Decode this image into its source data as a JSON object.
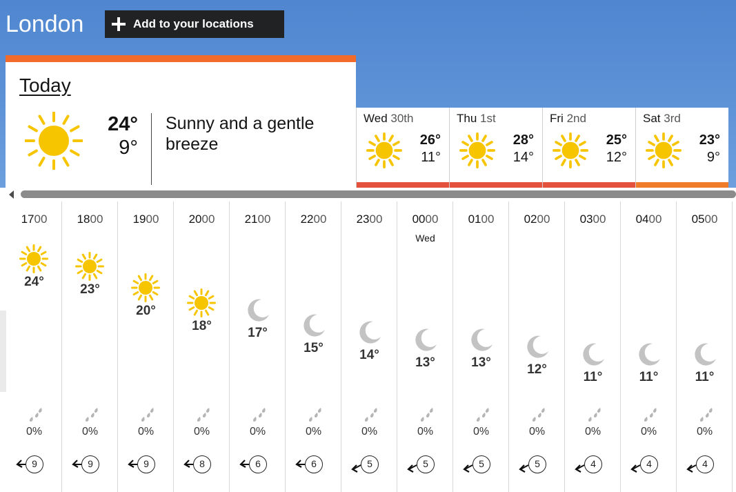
{
  "header": {
    "location": "London",
    "add_button_label": "Add to your locations"
  },
  "today": {
    "title": "Today",
    "icon": "sun-icon",
    "high": "24°",
    "low": "9°",
    "description": "Sunny and a gentle breeze"
  },
  "days": [
    {
      "day": "Wed",
      "date": "30th",
      "icon": "sun-icon",
      "high": "26°",
      "low": "11°",
      "bar_color": "#e4513c"
    },
    {
      "day": "Thu",
      "date": "1st",
      "icon": "sun-icon",
      "high": "28°",
      "low": "14°",
      "bar_color": "#e4513c"
    },
    {
      "day": "Fri",
      "date": "2nd",
      "icon": "sun-icon",
      "high": "25°",
      "low": "12°",
      "bar_color": "#e4513c"
    },
    {
      "day": "Sat",
      "date": "3rd",
      "icon": "sun-icon",
      "high": "23°",
      "low": "9°",
      "bar_color": "#f07c2a"
    }
  ],
  "hours": [
    {
      "hh": "17",
      "mm": "00",
      "day": "",
      "icon": "sun-icon",
      "temp": "24°",
      "rain": "0%",
      "wind": "9"
    },
    {
      "hh": "18",
      "mm": "00",
      "day": "",
      "icon": "sun-icon",
      "temp": "23°",
      "rain": "0%",
      "wind": "9"
    },
    {
      "hh": "19",
      "mm": "00",
      "day": "",
      "icon": "sun-icon",
      "temp": "20°",
      "rain": "0%",
      "wind": "9"
    },
    {
      "hh": "20",
      "mm": "00",
      "day": "",
      "icon": "sun-icon",
      "temp": "18°",
      "rain": "0%",
      "wind": "8"
    },
    {
      "hh": "21",
      "mm": "00",
      "day": "",
      "icon": "moon-icon",
      "temp": "17°",
      "rain": "0%",
      "wind": "6"
    },
    {
      "hh": "22",
      "mm": "00",
      "day": "",
      "icon": "moon-icon",
      "temp": "15°",
      "rain": "0%",
      "wind": "6"
    },
    {
      "hh": "23",
      "mm": "00",
      "day": "",
      "icon": "moon-icon",
      "temp": "14°",
      "rain": "0%",
      "wind": "5"
    },
    {
      "hh": "00",
      "mm": "00",
      "day": "Wed",
      "icon": "moon-icon",
      "temp": "13°",
      "rain": "0%",
      "wind": "5"
    },
    {
      "hh": "01",
      "mm": "00",
      "day": "",
      "icon": "moon-icon",
      "temp": "13°",
      "rain": "0%",
      "wind": "5"
    },
    {
      "hh": "02",
      "mm": "00",
      "day": "",
      "icon": "moon-icon",
      "temp": "12°",
      "rain": "0%",
      "wind": "5"
    },
    {
      "hh": "03",
      "mm": "00",
      "day": "",
      "icon": "moon-icon",
      "temp": "11°",
      "rain": "0%",
      "wind": "4"
    },
    {
      "hh": "04",
      "mm": "00",
      "day": "",
      "icon": "moon-icon",
      "temp": "11°",
      "rain": "0%",
      "wind": "4"
    },
    {
      "hh": "05",
      "mm": "00",
      "day": "",
      "icon": "moon-icon",
      "temp": "11°",
      "rain": "0%",
      "wind": "4"
    }
  ],
  "colors": {
    "sun": "#f7c400",
    "moon": "#c3c3c3",
    "accent_bar": "#f26b2a"
  }
}
